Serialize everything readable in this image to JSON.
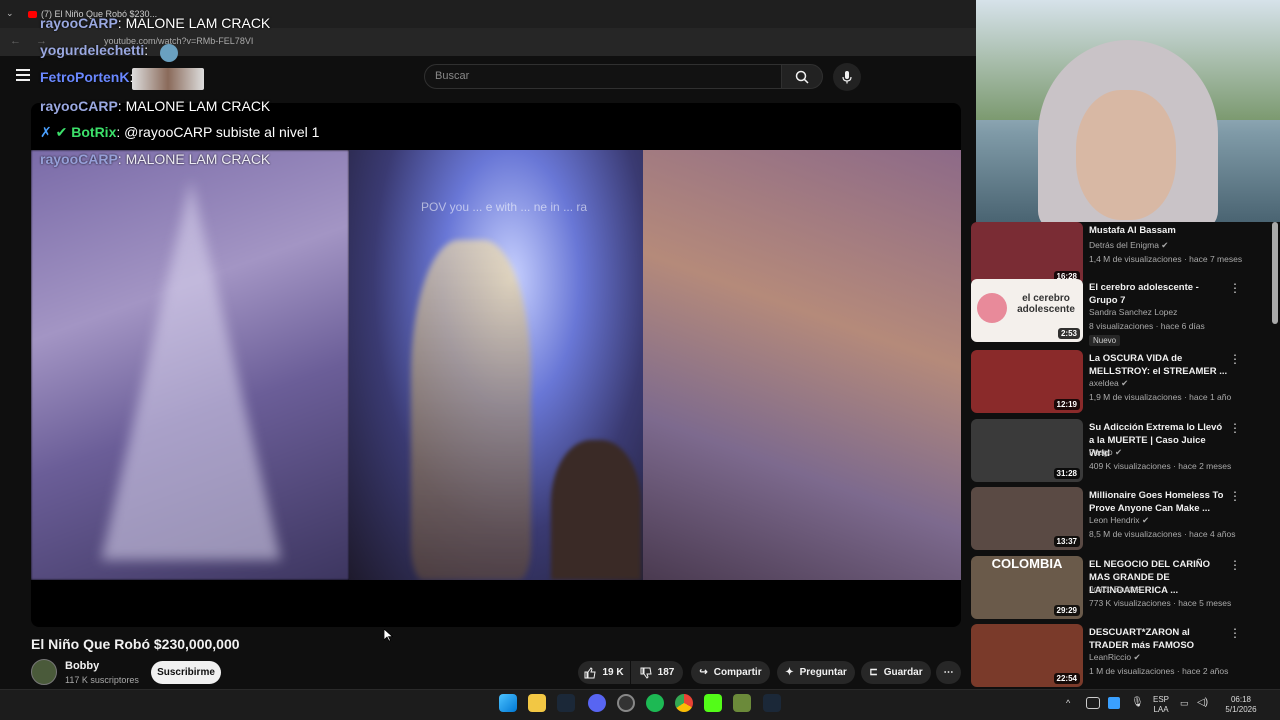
{
  "browser": {
    "tab_title": "(7) El Niño Que Robó $230...",
    "url": "youtube.com/watch?v=RMb-FEL78VI"
  },
  "header": {
    "search_placeholder": "Buscar"
  },
  "chat": [
    {
      "user": "rayooCARP",
      "text": ": MALONE LAM CRACK"
    },
    {
      "user": "yogurdelechetti",
      "text": ":"
    },
    {
      "user": "FetroPortenK",
      "text": ":"
    },
    {
      "user": "rayooCARP",
      "text": ": MALONE LAM CRACK"
    },
    {
      "user": "BotRix",
      "text": ": @rayooCARP subiste al nivel 1"
    },
    {
      "user": "rayooCARP",
      "text": ": MALONE LAM CRACK"
    }
  ],
  "video": {
    "overlay_text": "POV you ... e with ... ne in ... ra",
    "title": "El Niño Que Robó $230,000,000",
    "channel": "Bobby",
    "subscribers": "117 K suscriptores",
    "subscribe_label": "Suscribirme",
    "likes": "19 K",
    "dislikes": "187",
    "share_label": "Compartir",
    "ask_label": "Preguntar",
    "save_label": "Guardar"
  },
  "sidebar": [
    {
      "title": "Mustafa Al Bassam",
      "channel": "Detrás del Enigma",
      "meta": "1,4 M de visualizaciones · hace 7 meses",
      "duration": "16:28",
      "thumb": "#7a2c34",
      "verified": true
    },
    {
      "title": "El cerebro adolescente - Grupo 7",
      "channel": "Sandra Sanchez Lopez",
      "meta": "8 visualizaciones · hace 6 días",
      "duration": "2:53",
      "thumb": "#f4f0ec",
      "badge": "Nuevo",
      "thumb_text": "el cerebro adolescente"
    },
    {
      "title": "La OSCURA VIDA de MELLSTROY: el STREAMER ...",
      "channel": "axeldea",
      "meta": "1,9 M de visualizaciones · hace 1 año",
      "duration": "12:19",
      "thumb": "#8a2a2a",
      "verified": true
    },
    {
      "title": "Su Adicción Extrema lo Llevó a la MUERTE | Caso Juice Wrld",
      "channel": "Fusgo",
      "meta": "409 K visualizaciones · hace 2 meses",
      "duration": "31:28",
      "thumb": "#3a3a3a",
      "verified": true
    },
    {
      "title": "Millionaire Goes Homeless To Prove Anyone Can Make ...",
      "channel": "Leon Hendrix",
      "meta": "8,5 M de visualizaciones · hace 4 años",
      "duration": "13:37",
      "thumb": "#5a4a44",
      "verified": true
    },
    {
      "title": "EL NEGOCIO DEL CARIÑO MAS GRANDE DE LATINOAMERICA ...",
      "channel": "Joaco Santos",
      "meta": "773 K visualizaciones · hace 5 meses",
      "duration": "29:29",
      "thumb": "#6a5a4a",
      "thumb_text": "COLOMBIA"
    },
    {
      "title": "DESCUART*ZARON al TRADER más FAMOSO",
      "channel": "LeanRiccio",
      "meta": "1 M de visualizaciones · hace 2 años",
      "duration": "22:54",
      "thumb": "#7a3a2a",
      "verified": true
    }
  ],
  "taskbar": {
    "lang_top": "ESP",
    "lang_bottom": "LAA",
    "time": "06:18",
    "date": "5/1/2026"
  },
  "colors": {
    "background": "#0f0f0f",
    "chat_username": "#9aa8e0",
    "bot_name": "#3ce06a"
  }
}
